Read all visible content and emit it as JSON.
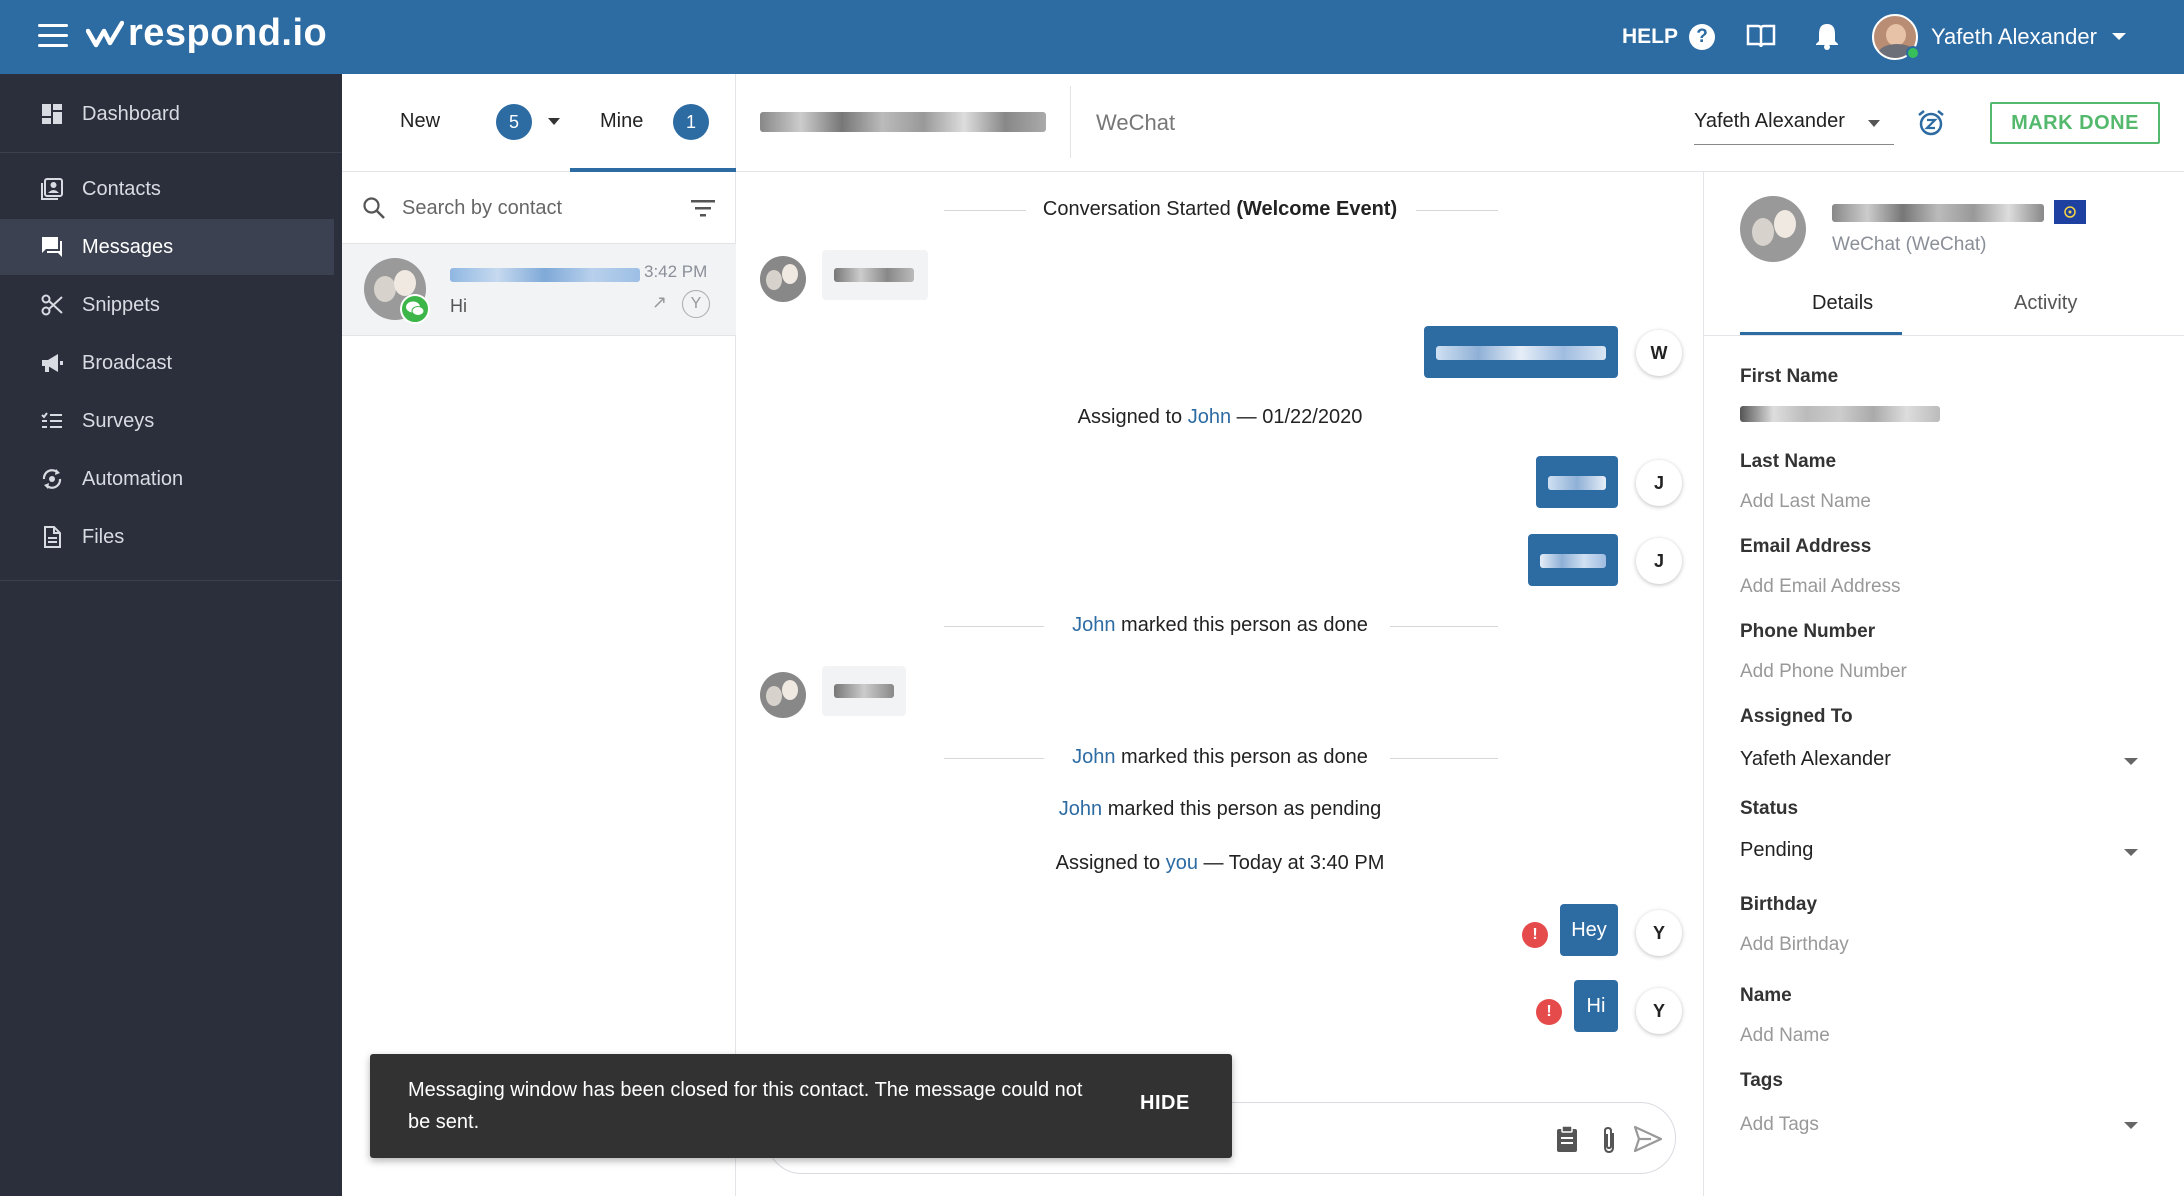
{
  "app": {
    "logo_text": "respond.io",
    "help_label": "HELP",
    "help_glyph": "?",
    "user_name": "Yafeth Alexander"
  },
  "sidebar": {
    "items": [
      {
        "label": "Dashboard",
        "icon": "dashboard-icon"
      },
      {
        "label": "Contacts",
        "icon": "contacts-icon"
      },
      {
        "label": "Messages",
        "icon": "messages-icon",
        "active": true
      },
      {
        "label": "Snippets",
        "icon": "scissors-icon"
      },
      {
        "label": "Broadcast",
        "icon": "megaphone-icon"
      },
      {
        "label": "Surveys",
        "icon": "surveys-icon"
      },
      {
        "label": "Automation",
        "icon": "automation-icon"
      },
      {
        "label": "Files",
        "icon": "file-icon"
      }
    ]
  },
  "conversations": {
    "tab_new_label": "New",
    "tab_new_count": "5",
    "tab_mine_label": "Mine",
    "tab_mine_count": "1",
    "search_placeholder": "Search by contact",
    "item": {
      "time": "3:42 PM",
      "preview": "Hi",
      "assignee_initial": "Y"
    }
  },
  "chat_header": {
    "channel": "WeChat",
    "assignee": "Yafeth Alexander",
    "mark_done_label": "MARK DONE"
  },
  "chat": {
    "started_prefix": "Conversation Started ",
    "started_event": "(Welcome Event)",
    "assigned1_prefix": "Assigned to ",
    "assigned1_name": "John",
    "assigned1_suffix": " — 01/22/2020",
    "done1_name": "John",
    "done1_text": " marked this person as done",
    "done2_name": "John",
    "done2_text": " marked this person as done",
    "pending_name": "John",
    "pending_text": " marked this person as pending",
    "assigned2_prefix": "Assigned to ",
    "assigned2_name": "you",
    "assigned2_suffix": " — Today at 3:40 PM",
    "sender_w": "W",
    "sender_j1": "J",
    "sender_j2": "J",
    "msg_hey": "Hey",
    "msg_hi": "Hi",
    "sender_y1": "Y",
    "sender_y2": "Y",
    "error_glyph": "!"
  },
  "snackbar": {
    "message": "Messaging window has been closed for this contact. The message could not be sent.",
    "hide_label": "HIDE"
  },
  "details": {
    "channel_label": "WeChat (WeChat)",
    "tab_details": "Details",
    "tab_activity": "Activity",
    "fields": {
      "first_name_label": "First Name",
      "last_name_label": "Last Name",
      "last_name_placeholder": "Add Last Name",
      "email_label": "Email Address",
      "email_placeholder": "Add Email Address",
      "phone_label": "Phone Number",
      "phone_placeholder": "Add Phone Number",
      "assigned_label": "Assigned To",
      "assigned_value": "Yafeth Alexander",
      "status_label": "Status",
      "status_value": "Pending",
      "birthday_label": "Birthday",
      "birthday_placeholder": "Add Birthday",
      "name_label": "Name",
      "name_placeholder": "Add Name",
      "tags_label": "Tags",
      "tags_placeholder": "Add Tags"
    }
  },
  "colors": {
    "brand": "#2d6ba3",
    "sidebar_bg": "#2a2f3b",
    "success": "#54b96d",
    "error": "#e64b4b",
    "wechat": "#3cb648"
  }
}
